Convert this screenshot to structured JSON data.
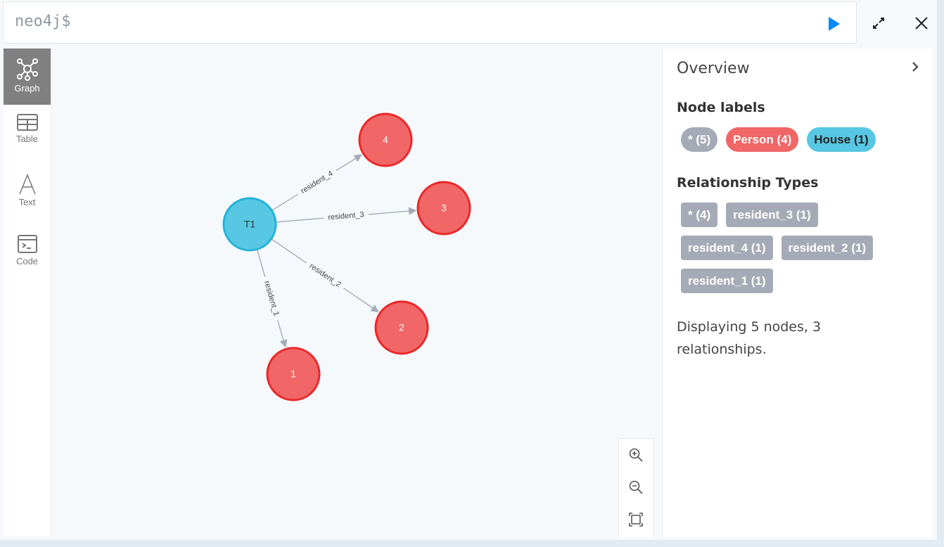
{
  "editor": {
    "prompt": "neo4j$"
  },
  "toolbar": {
    "run": "play-icon",
    "fullscreen": "expand-icon",
    "close": "close-icon"
  },
  "sidebar": {
    "items": [
      {
        "label": "Graph",
        "icon": "graph-icon",
        "active": true
      },
      {
        "label": "Table",
        "icon": "table-icon",
        "active": false
      },
      {
        "label": "Text",
        "icon": "text-icon",
        "active": false
      },
      {
        "label": "Code",
        "icon": "code-icon",
        "active": false
      }
    ]
  },
  "graph": {
    "colors": {
      "person_fill": "#f16667",
      "person_stroke": "#eb2728",
      "house_fill": "#57c7e3",
      "house_stroke": "#23b3d7",
      "rel": "#a5abb6"
    },
    "nodes": [
      {
        "id": "T1",
        "caption": "T1",
        "label": "House"
      },
      {
        "id": "n4",
        "caption": "4",
        "label": "Person"
      },
      {
        "id": "n3",
        "caption": "3",
        "label": "Person"
      },
      {
        "id": "n2",
        "caption": "2",
        "label": "Person"
      },
      {
        "id": "n1",
        "caption": "1",
        "label": "Person"
      }
    ],
    "relationships": [
      {
        "from": "T1",
        "to": "n4",
        "type": "resident_4"
      },
      {
        "from": "T1",
        "to": "n3",
        "type": "resident_3"
      },
      {
        "from": "T1",
        "to": "n2",
        "type": "resident_2"
      },
      {
        "from": "T1",
        "to": "n1",
        "type": "resident_1"
      }
    ]
  },
  "zoom_controls": [
    "zoom-in-icon",
    "zoom-out-icon",
    "fit-icon"
  ],
  "overview": {
    "title": "Overview",
    "node_labels_heading": "Node labels",
    "node_labels": [
      {
        "text": "* (5)",
        "color": "#a5abb6",
        "text_color": "#ffffff"
      },
      {
        "text": "Person (4)",
        "color": "#f16667",
        "text_color": "#ffffff"
      },
      {
        "text": "House (1)",
        "color": "#57c7e3",
        "text_color": "#222222"
      }
    ],
    "rel_types_heading": "Relationship Types",
    "rel_types": [
      "* (4)",
      "resident_3 (1)",
      "resident_4 (1)",
      "resident_2 (1)",
      "resident_1 (1)"
    ],
    "summary": "Displaying 5 nodes, 3 relationships."
  }
}
